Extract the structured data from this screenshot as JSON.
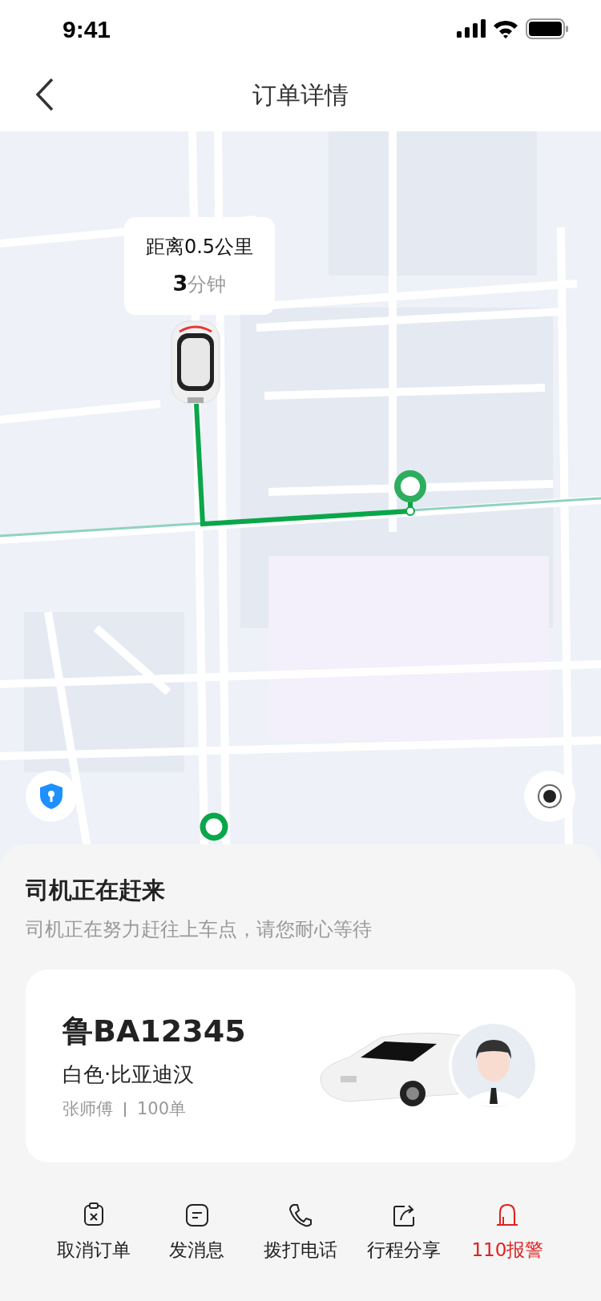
{
  "status_bar": {
    "time": "9:41"
  },
  "nav": {
    "title": "订单详情"
  },
  "map": {
    "bubble": {
      "distance": "距离0.5公里",
      "eta": "**3**分钟"
    }
  },
  "sheet": {
    "title": "司机正在赶来",
    "subtitle": "司机正在努力赶往上车点，请您耐心等待"
  },
  "driver_card": {
    "plate": "鲁BA12345",
    "vehicle": "白色·比亚迪汉",
    "driver_name": "张师傅",
    "order_count": "100单"
  },
  "actions": [
    {
      "kind": "cancel",
      "label": "取消订单",
      "alert": false
    },
    {
      "kind": "message",
      "label": "发消息",
      "alert": false
    },
    {
      "kind": "call",
      "label": "拨打电话",
      "alert": false
    },
    {
      "kind": "share",
      "label": "行程分享",
      "alert": false
    },
    {
      "kind": "alarm",
      "label": "110报警",
      "alert": true
    }
  ]
}
